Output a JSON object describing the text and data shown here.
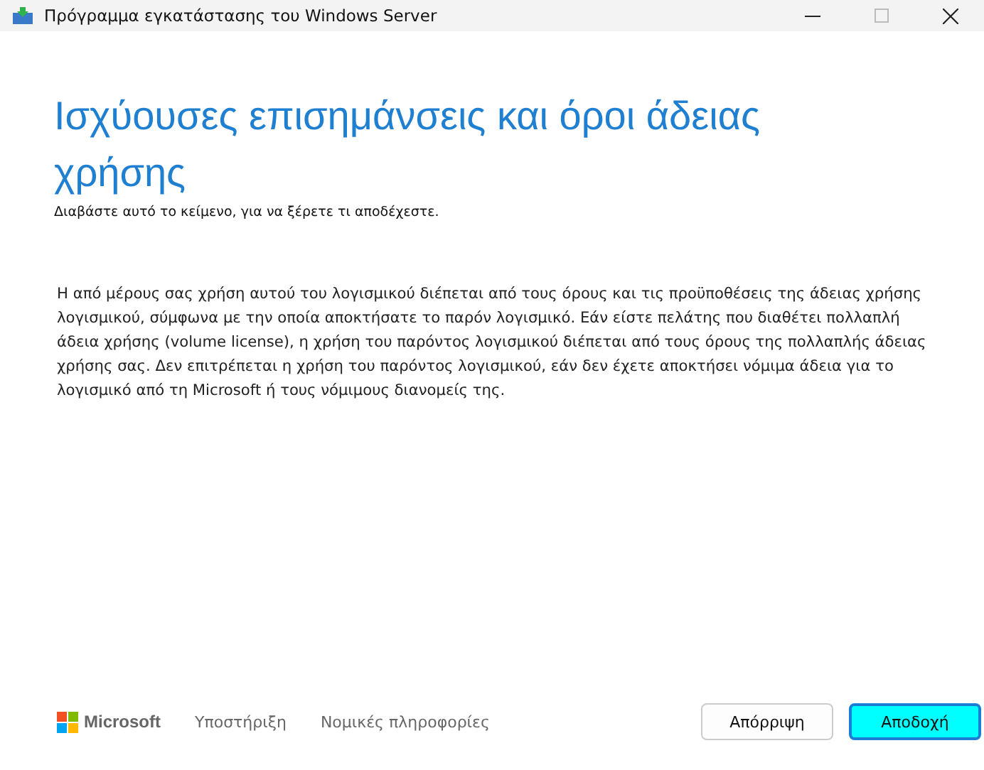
{
  "window": {
    "title": "Πρόγραμμα εγκατάστασης του Windows Server"
  },
  "heading": "Ισχύουσες επισημάνσεις και όροι άδειας χρήσης",
  "subtitle": "Διαβάστε αυτό το κείμενο, για να ξέρετε τι αποδέχεστε.",
  "license_text": "Η από μέρους σας χρήση αυτού του λογισμικού διέπεται από τους όρους και τις προϋποθέσεις της άδειας χρήσης λογισμικού, σύμφωνα με την οποία αποκτήσατε το παρόν λογισμικό. Εάν είστε πελάτης που διαθέτει πολλαπλή άδεια χρήσης (volume license), η χρήση του παρόντος λογισμικού διέπεται από τους όρους της πολλαπλής άδειας χρήσης σας. Δεν επιτρέπεται η χρήση του παρόντος λογισμικού, εάν δεν έχετε αποκτήσει νόμιμα άδεια για το λογισμικό από τη Microsoft ή τους νόμιμους διανομείς της.",
  "footer": {
    "brand": "Microsoft",
    "links": [
      "Υποστήριξη",
      "Νομικές πληροφορίες"
    ]
  },
  "buttons": [
    {
      "label": "Απόρριψη",
      "focused": false
    },
    {
      "label": "Αποδοχή",
      "focused": true
    }
  ]
}
